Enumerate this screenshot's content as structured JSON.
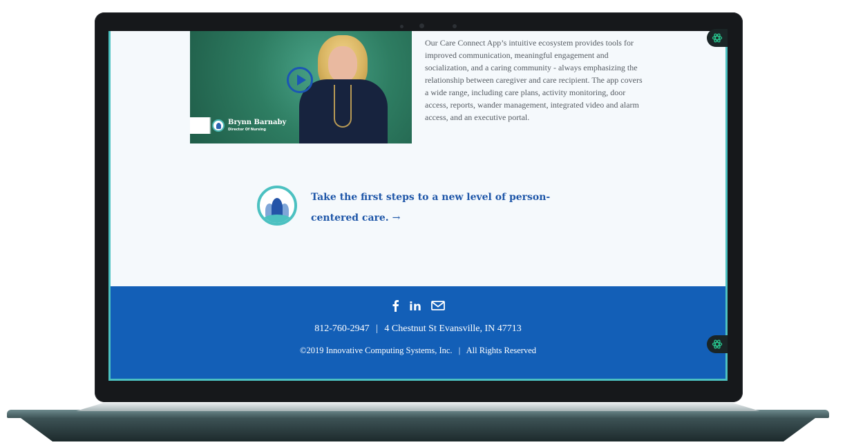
{
  "video": {
    "person_name": "Brynn Barnaby",
    "person_title": "Director Of Nursing"
  },
  "description": "Our Care Connect App’s intuitive ecosystem provides tools for improved communication, meaningful engagement and socialization, and a caring community - always emphasizing the relationship between caregiver and care recipient. The app covers a wide range, including care plans, activity monitoring, door access, reports, wander management, integrated video and alarm access, and an executive portal.",
  "cta": {
    "text": "Take the first steps to a new level of person-centered care.",
    "arrow": "→"
  },
  "footer": {
    "phone": "812-760-2947",
    "address": "4 Chestnut St Evansville, IN 47713",
    "copyright": "©2019 Innovative Computing Systems, Inc.",
    "rights": "All Rights Reserved",
    "separator": "|"
  },
  "icons": {
    "social": [
      "facebook-icon",
      "linkedin-icon",
      "email-icon"
    ],
    "extension": "openai-extension-icon"
  },
  "colors": {
    "footer_bg": "#135fb7",
    "accent_teal": "#4cc1c1",
    "cta_blue": "#1e56a8"
  }
}
